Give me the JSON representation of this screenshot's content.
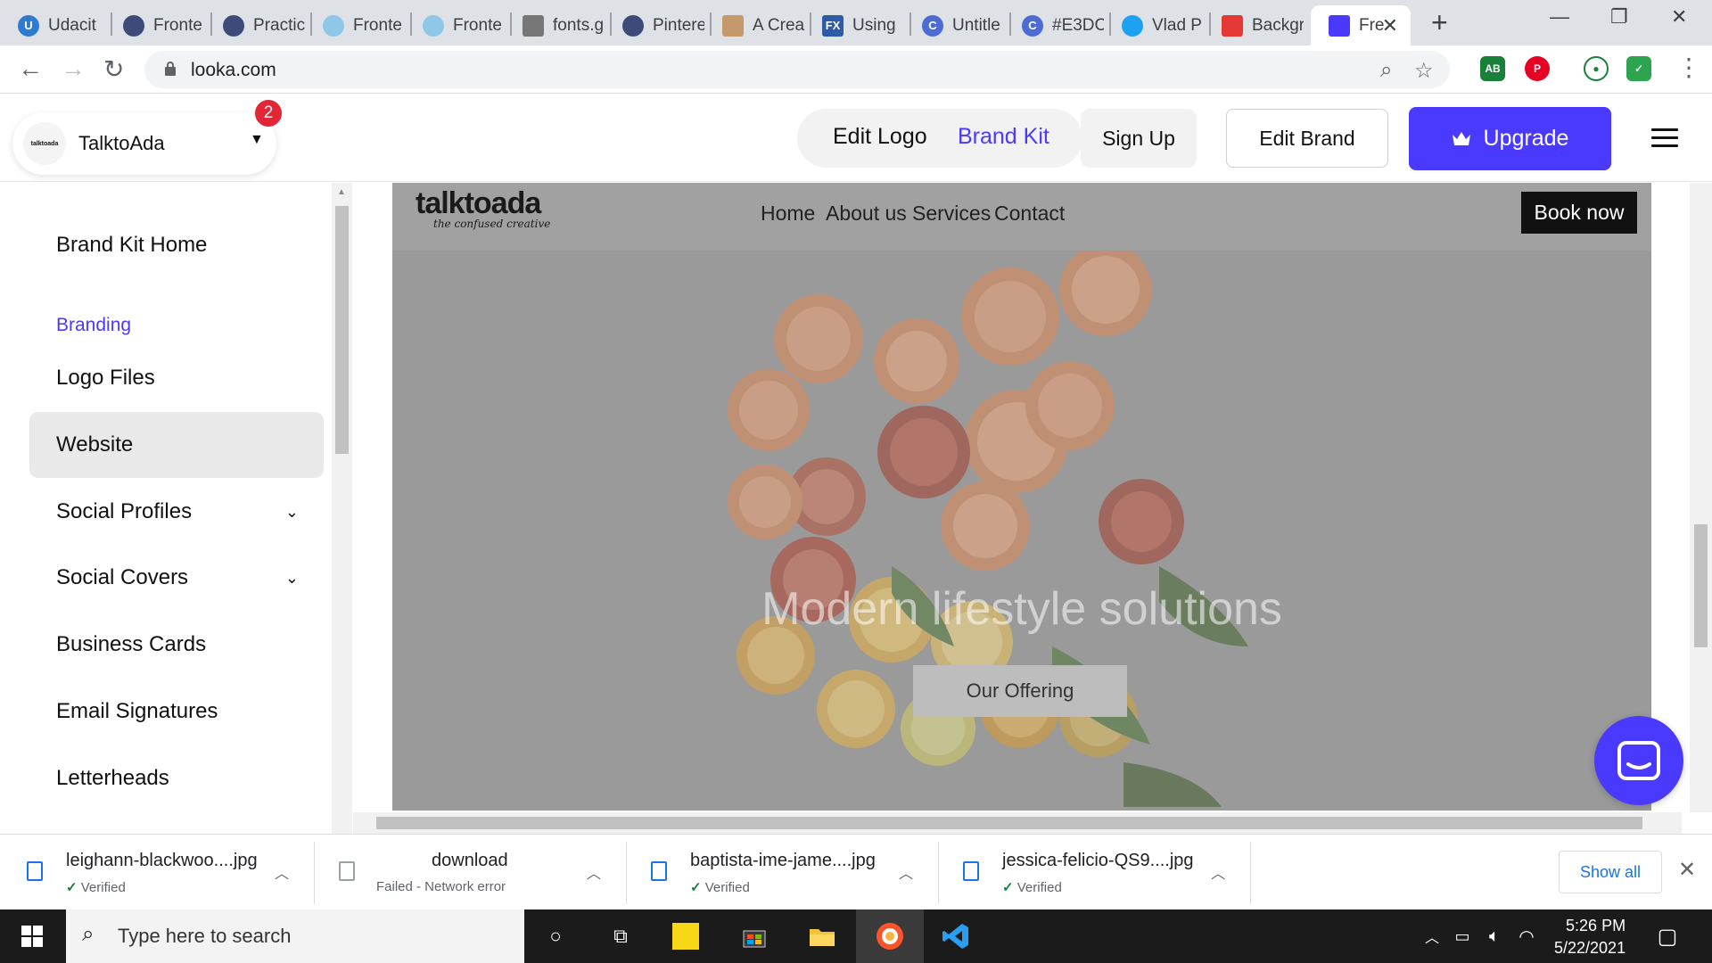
{
  "browser": {
    "tabs": [
      {
        "title": "Udacit",
        "color": "#2f7bd1"
      },
      {
        "title": "Fronte",
        "color": "#3c4b7a"
      },
      {
        "title": "Practic",
        "color": "#3c4b7a"
      },
      {
        "title": "Fronte",
        "color": "#8ec7e8"
      },
      {
        "title": "Fronte",
        "color": "#8ec7e8"
      },
      {
        "title": "fonts.g",
        "color": "#777777"
      },
      {
        "title": "Pintere",
        "color": "#3c4b7a"
      },
      {
        "title": "A Crea",
        "color": "#c49a6c"
      },
      {
        "title": "Using",
        "color": "#2e5aa8"
      },
      {
        "title": "Untitle",
        "color": "#4a6cd4"
      },
      {
        "title": "#E3DC",
        "color": "#4a6cd4"
      },
      {
        "title": "Vlad P",
        "color": "#1da1f2"
      },
      {
        "title": "Backgr",
        "color": "#e53935"
      },
      {
        "title": "Fre",
        "color": "#4a3aff"
      }
    ],
    "url": "looka.com"
  },
  "header": {
    "brand_name": "TalktoAda",
    "avatar_text": "talktoada",
    "notification_count": "2",
    "edit_logo": "Edit Logo",
    "brand_kit": "Brand Kit",
    "sign_up": "Sign Up",
    "edit_brand": "Edit Brand",
    "upgrade": "Upgrade"
  },
  "sidebar": {
    "home": "Brand Kit Home",
    "section": "Branding",
    "items": [
      "Logo Files",
      "Website",
      "Social Profiles",
      "Social Covers",
      "Business Cards",
      "Email Signatures",
      "Letterheads"
    ],
    "active": "Website"
  },
  "site": {
    "logo_word": "talktoada",
    "logo_tagline": "the confused creative",
    "menu": [
      "Home",
      "About us",
      "Services",
      "Contact"
    ],
    "book_now": "Book now",
    "hero_title": "Modern lifestyle solutions",
    "hero_button": "Our Offering"
  },
  "downloads": {
    "items": [
      {
        "name": "leighann-blackwoo....jpg",
        "status": "Verified",
        "ok": true
      },
      {
        "name": "download",
        "status": "Failed - Network error",
        "ok": false
      },
      {
        "name": "baptista-ime-jame....jpg",
        "status": "Verified",
        "ok": true
      },
      {
        "name": "jessica-felicio-QS9....jpg",
        "status": "Verified",
        "ok": true
      }
    ],
    "show_all": "Show all"
  },
  "taskbar": {
    "search_placeholder": "Type here to search",
    "time": "5:26 PM",
    "date": "5/22/2021"
  },
  "colors": {
    "accent": "#4a3aff",
    "badge": "#e32636"
  }
}
